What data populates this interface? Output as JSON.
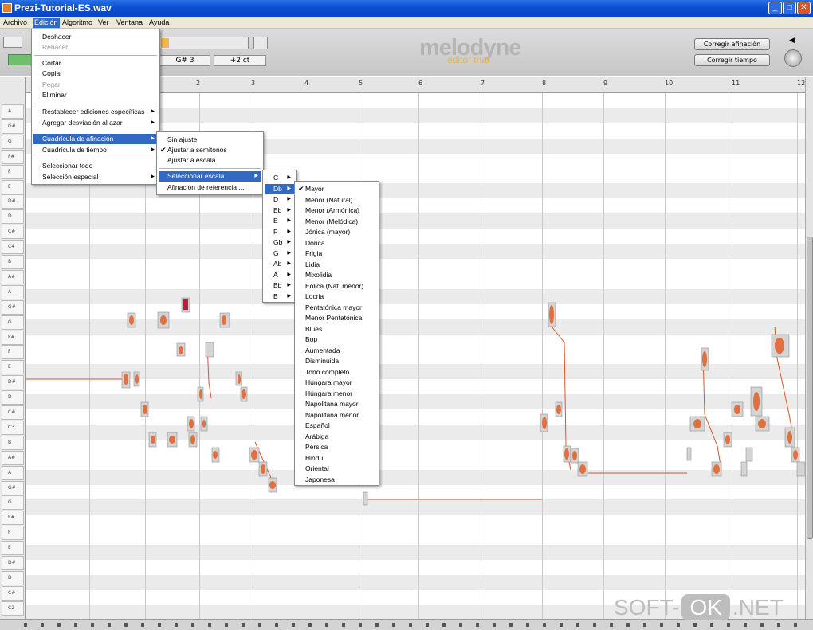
{
  "window": {
    "title": "Prezi-Tutorial-ES.wav",
    "min": "_",
    "max": "□",
    "close": "✕"
  },
  "menubar": [
    "Archivo",
    "Edición",
    "Algoritmo",
    "Ver",
    "Ventana",
    "Ayuda"
  ],
  "toolbar": {
    "note_value": "G# 3",
    "cents_value": "+2 ct",
    "logo": "melodyne",
    "logo_sub": "editor trial",
    "correct_pitch": "Corregir afinación",
    "correct_time": "Corregir tiempo"
  },
  "ruler": [
    "2",
    "3",
    "4",
    "5",
    "6",
    "7",
    "8",
    "9",
    "10",
    "11",
    "12"
  ],
  "keys": [
    "A",
    "G#",
    "G",
    "F#",
    "F",
    "E",
    "D#",
    "D",
    "C#",
    "C4",
    "B",
    "A#",
    "A",
    "G#",
    "G",
    "F#",
    "F",
    "E",
    "D#",
    "D",
    "C#",
    "C3",
    "B",
    "A#",
    "A",
    "G#",
    "G",
    "F#",
    "F",
    "E",
    "D#",
    "D",
    "C#",
    "C2"
  ],
  "edit_menu": [
    {
      "label": "Deshacer"
    },
    {
      "label": "Rehacer",
      "disabled": true
    },
    {
      "label": "Cortar"
    },
    {
      "label": "Copiar"
    },
    {
      "label": "Pegar",
      "disabled": true
    },
    {
      "label": "Eliminar"
    },
    {
      "label": "Restablecer ediciones específicas",
      "sub": true
    },
    {
      "label": "Agregar desviación al azar",
      "sub": true
    },
    {
      "label": "Cuadrícula de afinación",
      "sub": true,
      "hl": true
    },
    {
      "label": "Cuadrícula de tiempo",
      "sub": true
    },
    {
      "label": "Seleccionar todo"
    },
    {
      "label": "Selección especial",
      "sub": true
    }
  ],
  "grid_menu": [
    {
      "label": "Sin ajuste"
    },
    {
      "label": "Ajustar a semitonos",
      "checked": true
    },
    {
      "label": "Ajustar a escala"
    },
    {
      "label": "Seleccionar escala",
      "sub": true,
      "hl": true
    },
    {
      "label": "Afinación de referencia ..."
    }
  ],
  "key_menu": [
    "C",
    "Db",
    "D",
    "Eb",
    "E",
    "F",
    "Gb",
    "G",
    "Ab",
    "A",
    "Bb",
    "B"
  ],
  "key_selected": "Db",
  "scale_menu": [
    "Mayor",
    "Menor (Natural)",
    "Menor (Armónica)",
    "Menor (Melódica)",
    "Jónica (mayor)",
    "Dórica",
    "Frigia",
    "Lidia",
    "Mixolidia",
    "Eólica (Nat. menor)",
    "Locria",
    "Pentatónica mayor",
    "Menor Pentatónica",
    "Blues",
    "Bop",
    "Aumentada",
    "Disminuida",
    "Tono completo",
    "Húngara mayor",
    "Húngara menor",
    "Napolitana mayor",
    "Napolitana menor",
    "Español",
    "Arábiga",
    "Pérsica",
    "Hindú",
    "Oriental",
    "Japonesa"
  ],
  "scale_checked": "Mayor",
  "watermark": {
    "left": "SOFT-",
    "pill": "OK",
    "right": ".NET"
  },
  "colors": {
    "accent": "#316ac5",
    "note": "#e07040",
    "blob": "#d4d4d4"
  }
}
